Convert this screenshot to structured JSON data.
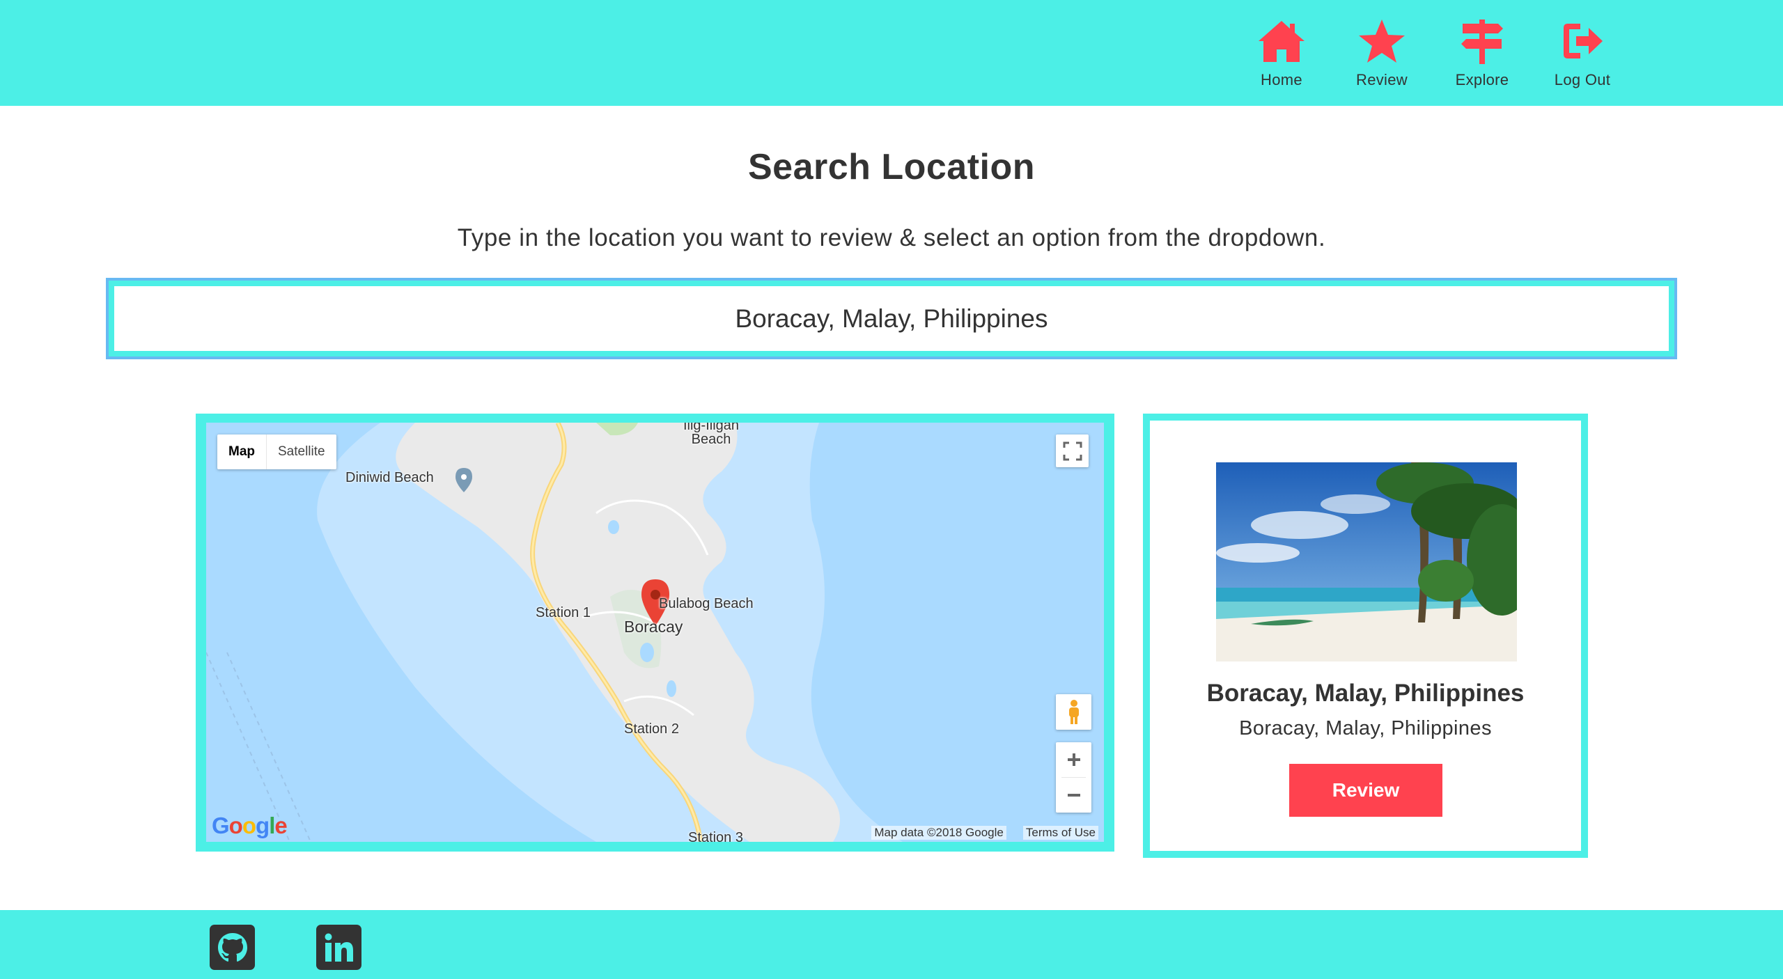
{
  "header": {
    "nav": [
      {
        "label": "Home",
        "icon": "home-icon"
      },
      {
        "label": "Review",
        "icon": "star-icon"
      },
      {
        "label": "Explore",
        "icon": "signpost-icon"
      },
      {
        "label": "Log Out",
        "icon": "logout-icon"
      }
    ],
    "accent_color": "#4CEFE6",
    "icon_color": "#FF424F"
  },
  "main": {
    "title": "Search Location",
    "subtitle": "Type in the location you want to review & select an option from the dropdown.",
    "search": {
      "value": "Boracay, Malay, Philippines"
    }
  },
  "map": {
    "type_controls": [
      "Map",
      "Satellite"
    ],
    "active_type": "Map",
    "labels": [
      "Diniwid Beach",
      "Station 1",
      "Boracay",
      "Bulabog Beach",
      "Station 2",
      "Station 3",
      "Ilig-Iligan Beach"
    ],
    "attribution": "Map data ©2018 Google",
    "terms": "Terms of Use",
    "logo": "Google"
  },
  "card": {
    "title": "Boracay, Malay, Philippines",
    "subtitle": "Boracay, Malay, Philippines",
    "button": "Review"
  },
  "footer": {
    "links": [
      {
        "icon": "github-icon"
      },
      {
        "icon": "linkedin-icon"
      }
    ]
  }
}
